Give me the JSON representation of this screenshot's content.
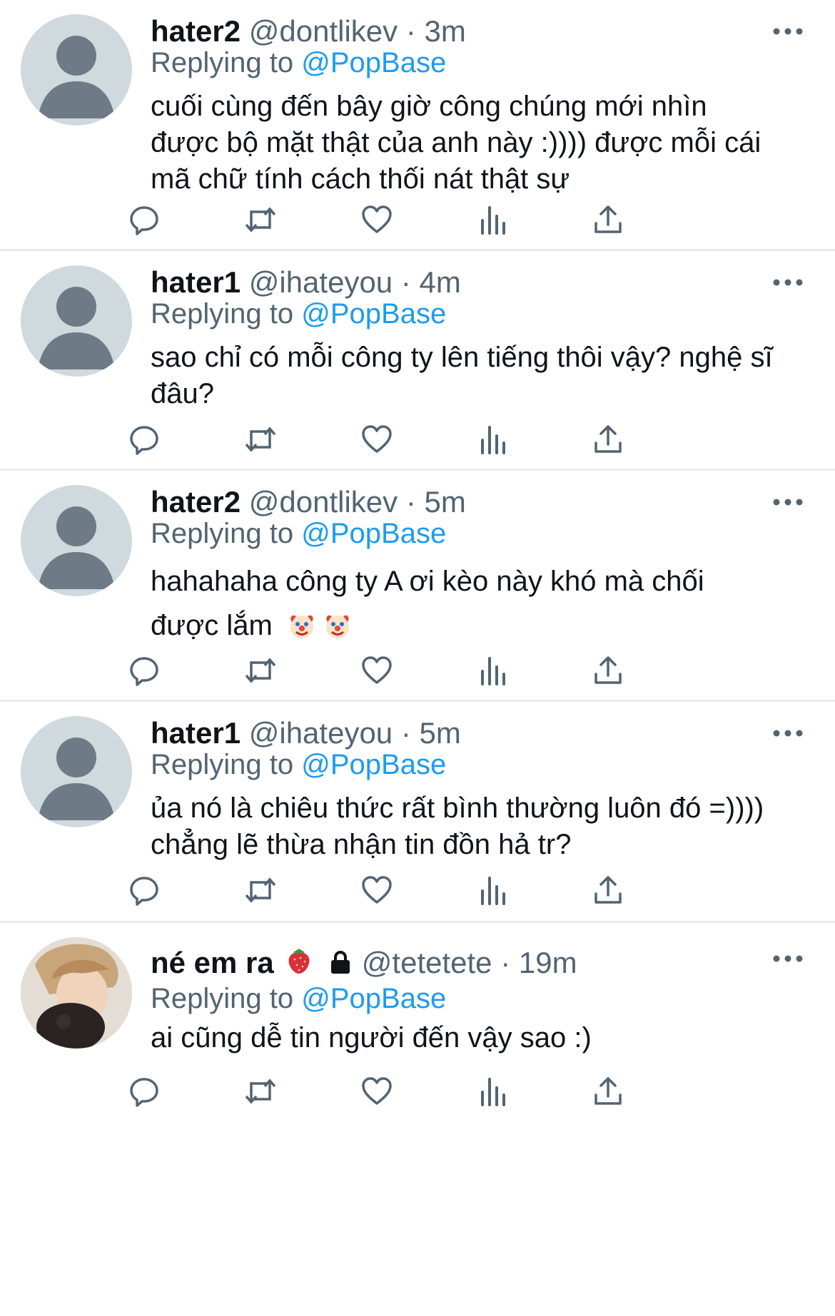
{
  "colors": {
    "text": "#0f1419",
    "secondary": "#536471",
    "mention": "#1d9bf0",
    "divider": "#e6ecf0",
    "avatar_bg": "#cfd9de"
  },
  "reply_prefix": "Replying to",
  "tweets": [
    {
      "name": "hater2",
      "handle": "@dontlikev",
      "separator": "·",
      "time": "3m",
      "reply_to": "@PopBase",
      "text": "cuối cùng đến bây giờ công chúng mới nhìn được bộ mặt thật của anh này :)))) được mỗi cái mã chữ tính cách thối nát thật sự",
      "avatar": "default-avatar-icon"
    },
    {
      "name": "hater1",
      "handle": "@ihateyou",
      "separator": "·",
      "time": "4m",
      "reply_to": "@PopBase",
      "text": "sao chỉ có mỗi công ty lên tiếng thôi vậy? nghệ sĩ đâu?",
      "avatar": "default-avatar-icon"
    },
    {
      "name": "hater2",
      "handle": "@dontlikev",
      "separator": "·",
      "time": "5m",
      "reply_to": "@PopBase",
      "text": "hahahaha công ty A ơi kèo này khó mà chối được lắm",
      "emojis": [
        "clown-face-emoji",
        "clown-face-emoji"
      ],
      "avatar": "default-avatar-icon"
    },
    {
      "name": "hater1",
      "handle": "@ihateyou",
      "separator": "·",
      "time": "5m",
      "reply_to": "@PopBase",
      "text": "ủa nó là chiêu thức rất bình thường luôn đó =)))) chẳng lẽ thừa nhận tin đồn hả tr?",
      "avatar": "default-avatar-icon"
    },
    {
      "name": "né em ra",
      "name_emoji": "strawberry-emoji",
      "locked": "lock-icon",
      "handle": "@tetetete",
      "separator": "·",
      "time": "19m",
      "reply_to": "@PopBase",
      "text": "ai cũng dễ tin người đến vậy sao :)",
      "avatar": "photo-avatar"
    }
  ],
  "action_icons": [
    "reply-icon",
    "retweet-icon",
    "like-icon",
    "analytics-icon",
    "share-icon"
  ],
  "more_icon": "more-options-icon"
}
